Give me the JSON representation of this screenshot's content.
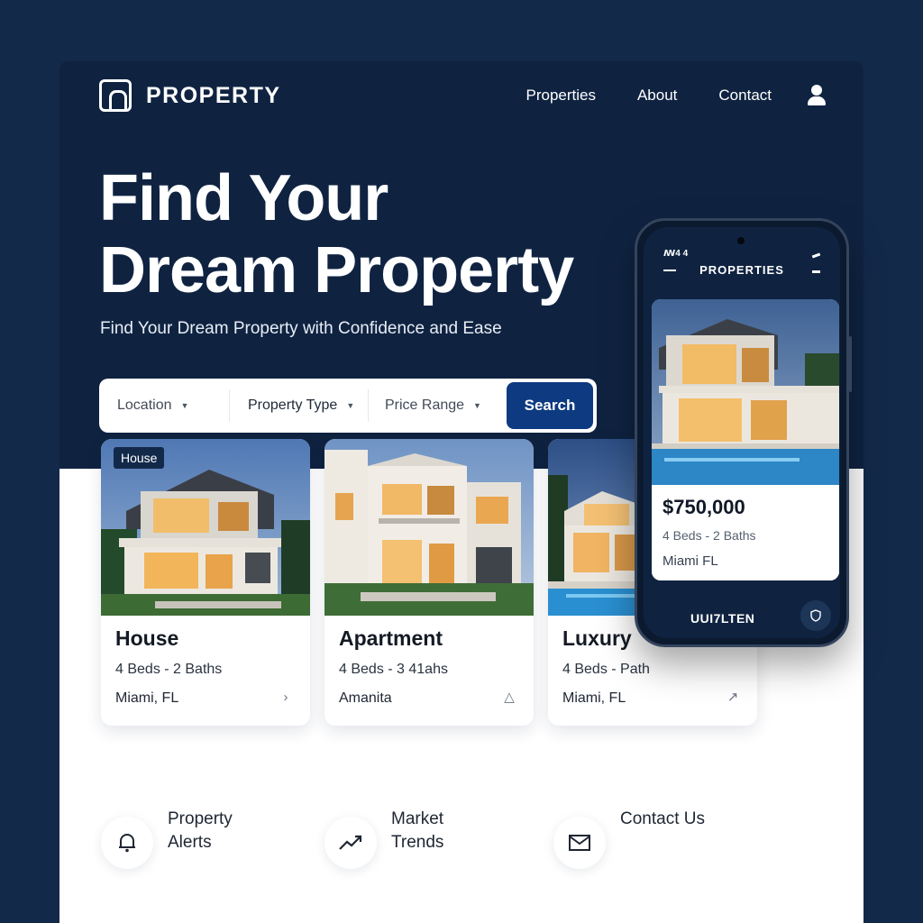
{
  "brand": {
    "name": "PROPERTY",
    "logo_icon": "arch-logo-icon"
  },
  "nav": {
    "links": [
      "Properties",
      "About",
      "Contact"
    ],
    "user_icon": "user-icon"
  },
  "hero": {
    "title_line1": "Find Your",
    "title_line2": "Dream Property",
    "subtitle": "Find Your Dream Property with Confidence and Ease"
  },
  "search": {
    "location": "Location",
    "property_type": "Property Type",
    "price_range": "Price Range",
    "button": "Search"
  },
  "cards": [
    {
      "badge": "House",
      "title": "House",
      "spec": "4 Beds - 2 Baths",
      "location": "Miami, FL",
      "action_icon": "chevron-right-icon"
    },
    {
      "title": "Apartment",
      "spec": "4 Beds - 3 41ahs",
      "location": "Amanita",
      "action_icon": "triangle-up-icon"
    },
    {
      "title": "Luxury",
      "spec": "4 Beds - Path",
      "location": "Miami, FL",
      "action_icon": "arrow-diagonal-icon"
    }
  ],
  "features": [
    {
      "label_line1": "Property",
      "label_line2": "Alerts",
      "icon": "bell-icon"
    },
    {
      "label_line1": "Market",
      "label_line2": "Trends",
      "icon": "trend-up-icon"
    },
    {
      "label_line1": "Contact Us",
      "label_line2": "",
      "icon": "mail-icon"
    }
  ],
  "phone": {
    "status": "ꟿ4 4",
    "title": "PROPERTIES",
    "price": "$750,000",
    "spec": "4 Beds - 2 Baths",
    "location": "Miami FL",
    "brand": "UUI7LTEN"
  },
  "colors": {
    "hero_bg": "#0f2341",
    "page_bg": "#13294a",
    "button_bg": "#0d3a80"
  }
}
